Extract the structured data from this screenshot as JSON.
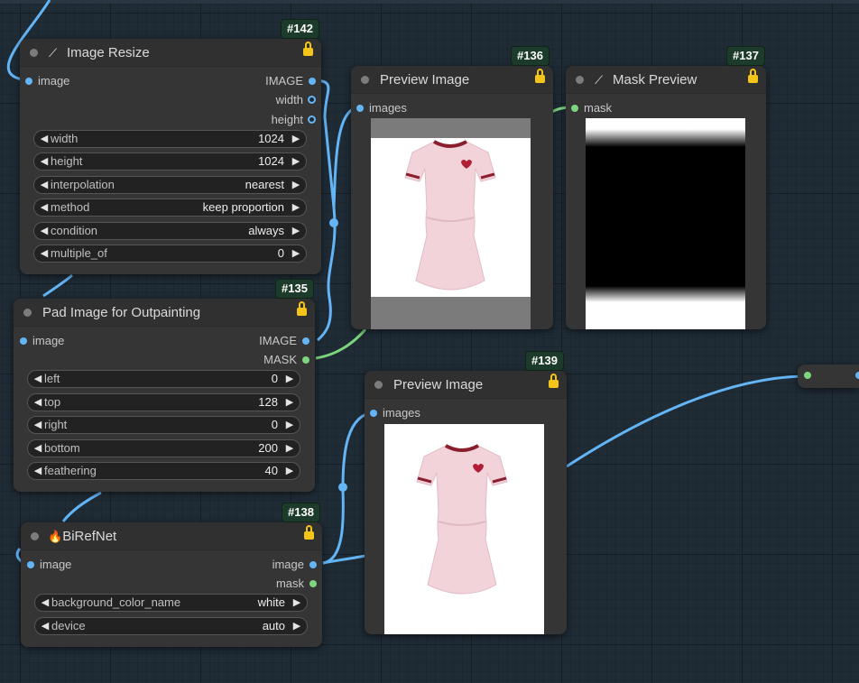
{
  "nodes": {
    "image_resize": {
      "id": "#142",
      "title": "Image Resize",
      "inputs": [
        "image"
      ],
      "outputs": [
        "IMAGE",
        "width",
        "height"
      ],
      "widgets": [
        {
          "label": "width",
          "value": "1024"
        },
        {
          "label": "height",
          "value": "1024"
        },
        {
          "label": "interpolation",
          "value": "nearest"
        },
        {
          "label": "method",
          "value": "keep proportion"
        },
        {
          "label": "condition",
          "value": "always"
        },
        {
          "label": "multiple_of",
          "value": "0"
        }
      ]
    },
    "preview_136": {
      "id": "#136",
      "title": "Preview Image",
      "inputs": [
        "images"
      ]
    },
    "mask_preview": {
      "id": "#137",
      "title": "Mask Preview",
      "inputs": [
        "mask"
      ]
    },
    "pad_image": {
      "id": "#135",
      "title": "Pad Image for Outpainting",
      "inputs": [
        "image"
      ],
      "outputs": [
        "IMAGE",
        "MASK"
      ],
      "widgets": [
        {
          "label": "left",
          "value": "0"
        },
        {
          "label": "top",
          "value": "128"
        },
        {
          "label": "right",
          "value": "0"
        },
        {
          "label": "bottom",
          "value": "200"
        },
        {
          "label": "feathering",
          "value": "40"
        }
      ]
    },
    "preview_139": {
      "id": "#139",
      "title": "Preview Image",
      "inputs": [
        "images"
      ]
    },
    "birefnet": {
      "id": "#138",
      "title": "BiRefNet",
      "title_icon": "🔥",
      "inputs": [
        "image"
      ],
      "outputs": [
        "image",
        "mask"
      ],
      "widgets": [
        {
          "label": "background_color_name",
          "value": "white"
        },
        {
          "label": "device",
          "value": "auto"
        }
      ]
    }
  },
  "icons": {
    "wrench": "wrench-icon",
    "lock": "lock-icon",
    "fire": "fire-icon",
    "arrow_left": "◀",
    "arrow_right": "▶"
  },
  "colors": {
    "canvas_bg": "#1f2b35",
    "node_bg": "#353535",
    "image_link": "#64b5f6",
    "mask_link": "#7cd47c",
    "badge_bg": "#1d3b2a",
    "lock": "#f3c51b",
    "dress": "#f2d3da",
    "trim": "#8b1f2e"
  }
}
